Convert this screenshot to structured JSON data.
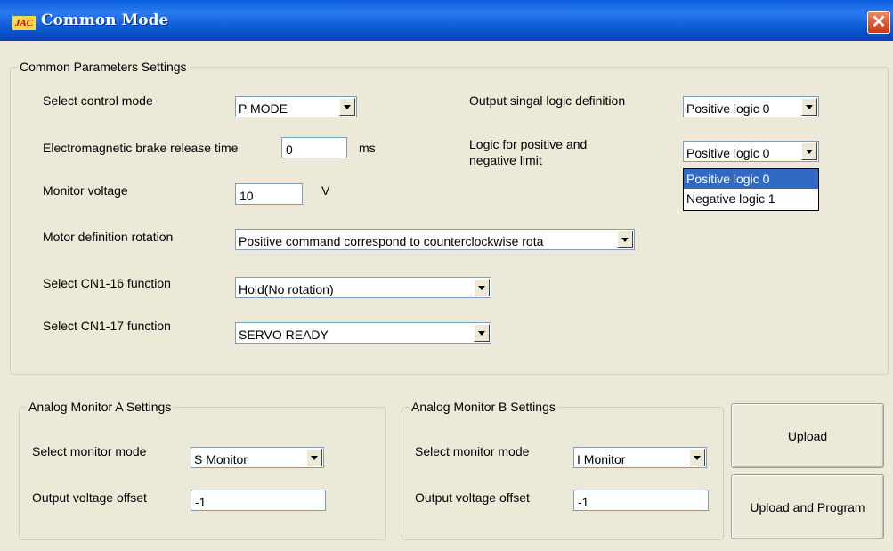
{
  "window": {
    "title": "Common Mode",
    "logo_text": "JAC",
    "close_glyph": "✕"
  },
  "common": {
    "legend": "Common Parameters Settings",
    "control_mode_label": "Select control mode",
    "control_mode_value": "P MODE",
    "brake_label": "Electromagnetic brake release time",
    "brake_value": "0",
    "brake_unit": "ms",
    "monitor_voltage_label": "Monitor voltage",
    "monitor_voltage_value": "10",
    "monitor_voltage_unit": "V",
    "motor_rotation_label": "Motor definition rotation",
    "motor_rotation_value": "Positive command correspond to counterclockwise rota",
    "cn1_16_label": "Select CN1-16 function",
    "cn1_16_value": "Hold(No rotation)",
    "cn1_17_label": "Select CN1-17 function",
    "cn1_17_value": "SERVO READY",
    "output_logic_label": "Output singal logic definition",
    "output_logic_value": "Positive logic 0",
    "limit_logic_label_line1": "Logic for positive and",
    "limit_logic_label_line2": "negative limit",
    "limit_logic_value": "Positive logic 0",
    "limit_logic_options": [
      "Positive logic 0",
      "Negative logic 1"
    ]
  },
  "monitor_a": {
    "legend": "Analog Monitor A Settings",
    "mode_label": "Select monitor mode",
    "mode_value": "S Monitor",
    "offset_label": "Output voltage offset",
    "offset_value": "-1"
  },
  "monitor_b": {
    "legend": "Analog Monitor B Settings",
    "mode_label": "Select monitor mode",
    "mode_value": "I Monitor",
    "offset_label": "Output voltage offset",
    "offset_value": "-1"
  },
  "buttons": {
    "upload": "Upload",
    "upload_program": "Upload and Program"
  },
  "colors": {
    "titlebar": "#0a5ddb",
    "dialog_bg": "#ece9d8",
    "selection": "#316ac5",
    "close": "#d9542f"
  }
}
